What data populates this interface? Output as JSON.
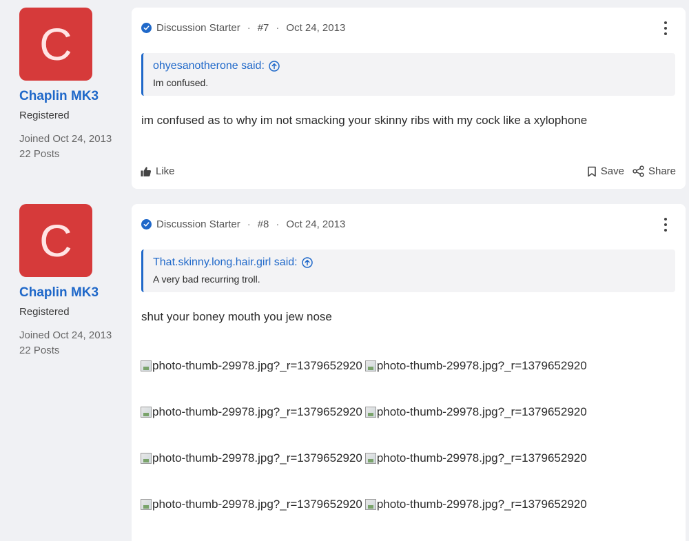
{
  "posts": [
    {
      "user": {
        "avatar_letter": "C",
        "avatar_color": "#d63a3a",
        "name": "Chaplin MK3",
        "role": "Registered",
        "joined": "Joined Oct 24, 2013",
        "posts": "22 Posts"
      },
      "badge": "Discussion Starter",
      "number": "#7",
      "date": "Oct 24, 2013",
      "quote": {
        "author": "ohyesanotherone said:",
        "text": "Im confused."
      },
      "body": "im confused as to why im not smacking your skinny ribs with my cock like a xylophone",
      "actions": {
        "like": "Like",
        "save": "Save",
        "share": "Share"
      }
    },
    {
      "user": {
        "avatar_letter": "C",
        "avatar_color": "#d63a3a",
        "name": "Chaplin MK3",
        "role": "Registered",
        "joined": "Joined Oct 24, 2013",
        "posts": "22 Posts"
      },
      "badge": "Discussion Starter",
      "number": "#8",
      "date": "Oct 24, 2013",
      "quote": {
        "author": "That.skinny.long.hair.girl said:",
        "text": "A very bad recurring troll."
      },
      "body": "shut your boney mouth you jew nose",
      "images": [
        [
          "photo-thumb-29978.jpg?_r=1379652920",
          "photo-thumb-29978.jpg?_r=1379652920"
        ],
        [
          "photo-thumb-29978.jpg?_r=1379652920",
          "photo-thumb-29978.jpg?_r=1379652920"
        ],
        [
          "photo-thumb-29978.jpg?_r=1379652920",
          "photo-thumb-29978.jpg?_r=1379652920"
        ],
        [
          "photo-thumb-29978.jpg?_r=1379652920",
          "photo-thumb-29978.jpg?_r=1379652920"
        ]
      ]
    }
  ],
  "colors": {
    "accent": "#1f68c9",
    "avatar": "#d63a3a",
    "page_bg": "#f0f1f4"
  },
  "icons": {
    "verified": "check-circle-icon",
    "more": "kebab-menu-icon",
    "quote_jump": "arrow-up-circle-icon",
    "like": "thumbs-up-icon",
    "save": "bookmark-icon",
    "share": "share-icon",
    "broken_image": "broken-image-icon"
  }
}
